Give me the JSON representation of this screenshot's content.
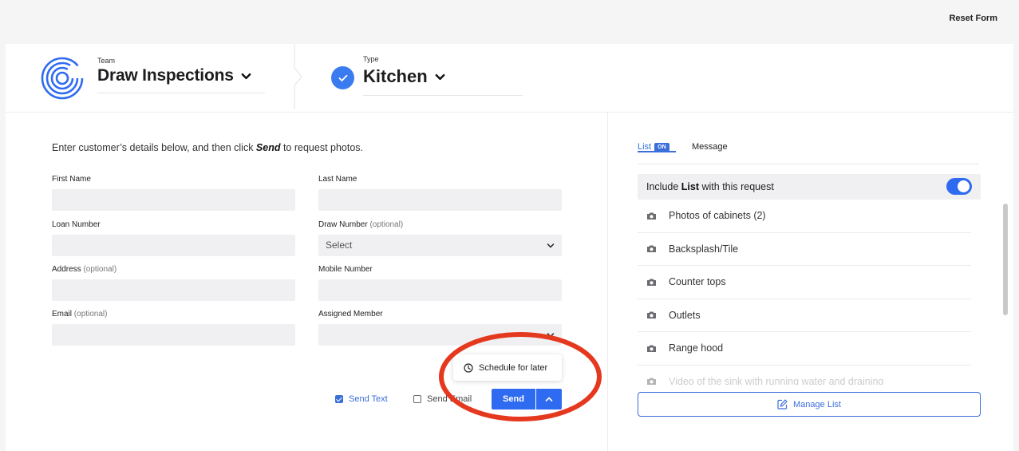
{
  "top": {
    "reset_label": "Reset Form"
  },
  "header": {
    "team_label": "Team",
    "team_value": "Draw Inspections",
    "type_label": "Type",
    "type_value": "Kitchen"
  },
  "form": {
    "intro_before": "Enter customer’s details below, and then click ",
    "intro_em": "Send",
    "intro_after": " to request photos.",
    "first_name_label": "First Name",
    "last_name_label": "Last Name",
    "loan_number_label": "Loan Number",
    "draw_number_label": "Draw Number",
    "draw_number_optional": "(optional)",
    "draw_number_value": "Select",
    "address_label": "Address",
    "address_optional": "(optional)",
    "mobile_label": "Mobile Number",
    "email_label": "Email",
    "email_optional": "(optional)",
    "assigned_label": "Assigned Member",
    "send_text_label": "Send Text",
    "send_text_checked": true,
    "send_email_label": "Send Email",
    "send_email_checked": false,
    "send_label": "Send",
    "schedule_label": "Schedule for later"
  },
  "panel": {
    "tab_list": "List",
    "tab_list_badge": "ON",
    "tab_message": "Message",
    "include_before": "Include ",
    "include_bold": "List",
    "include_after": " with this request",
    "include_on": true,
    "items": [
      "Photos of cabinets (2)",
      "Backsplash/Tile",
      "Counter tops",
      "Outlets",
      "Range hood",
      "Video of the sink with running water and draining"
    ],
    "manage_label": "Manage List"
  },
  "colors": {
    "accent": "#2f6bf0",
    "annotation": "#e5391f"
  }
}
